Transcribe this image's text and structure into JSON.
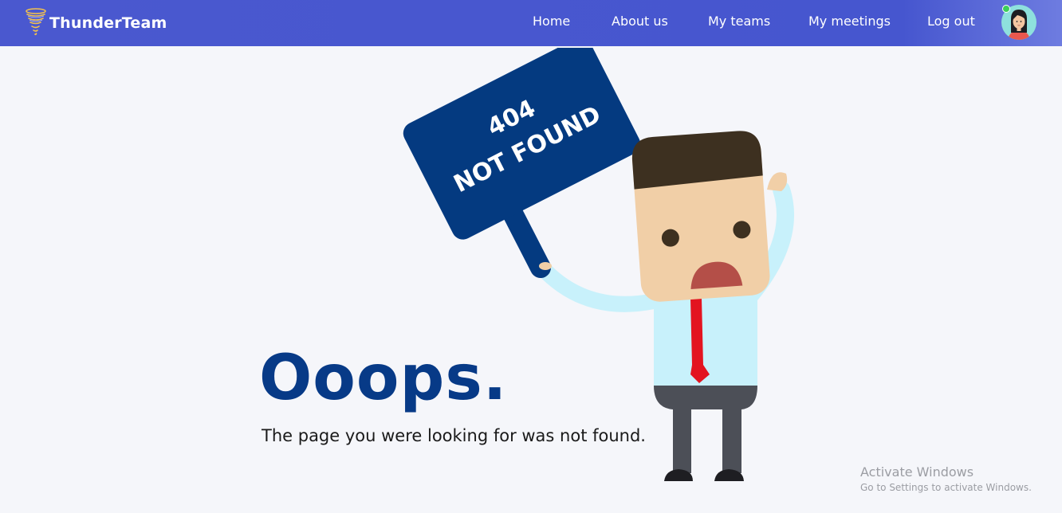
{
  "brand": {
    "name": "ThunderTeam",
    "logo_icon": "tornado-icon"
  },
  "nav": {
    "items": [
      {
        "label": "Home"
      },
      {
        "label": "About us"
      },
      {
        "label": "My teams"
      },
      {
        "label": "My meetings"
      },
      {
        "label": "Log out"
      }
    ],
    "avatar_icon": "user-avatar-icon",
    "status": "online"
  },
  "illustration": {
    "sign_code": "404",
    "sign_text": "NOT FOUND"
  },
  "error": {
    "title": "Ooops.",
    "message": "The page you were looking for was not found."
  },
  "watermark": {
    "title": "Activate Windows",
    "subtitle": "Go to Settings to activate Windows."
  },
  "colors": {
    "navbar": "#4656cf",
    "title": "#073a87",
    "sign": "#043a80",
    "background": "#f5f6fa",
    "status_online": "#3ccf5a"
  }
}
